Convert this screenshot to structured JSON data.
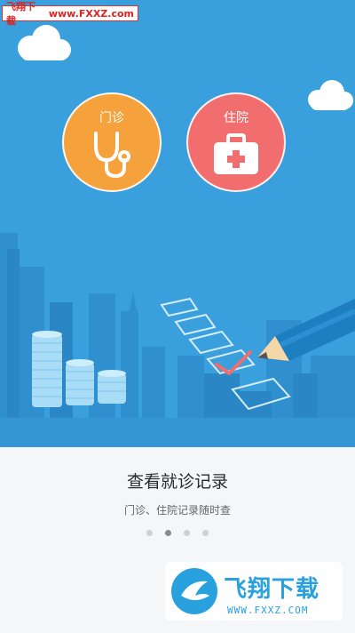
{
  "watermark_top": {
    "site_cn": "飞翔下载",
    "url": "www.FXXZ.com"
  },
  "modules": [
    {
      "label": "门诊",
      "icon": "stethoscope-icon",
      "color": "#f6a23c"
    },
    {
      "label": "住院",
      "icon": "first-aid-kit-icon",
      "color": "#f26d6d"
    }
  ],
  "intro": {
    "title": "查看就诊记录",
    "subtitle": "门诊、住院记录随时查"
  },
  "pager": {
    "total": 4,
    "active": 2
  },
  "watermark_bottom": {
    "brand": "飞翔下载",
    "url": "WWW.FXXZ.COM"
  },
  "colors": {
    "hero_bg": "#3a9fdd",
    "bottom_bg": "#f4f6f8"
  }
}
